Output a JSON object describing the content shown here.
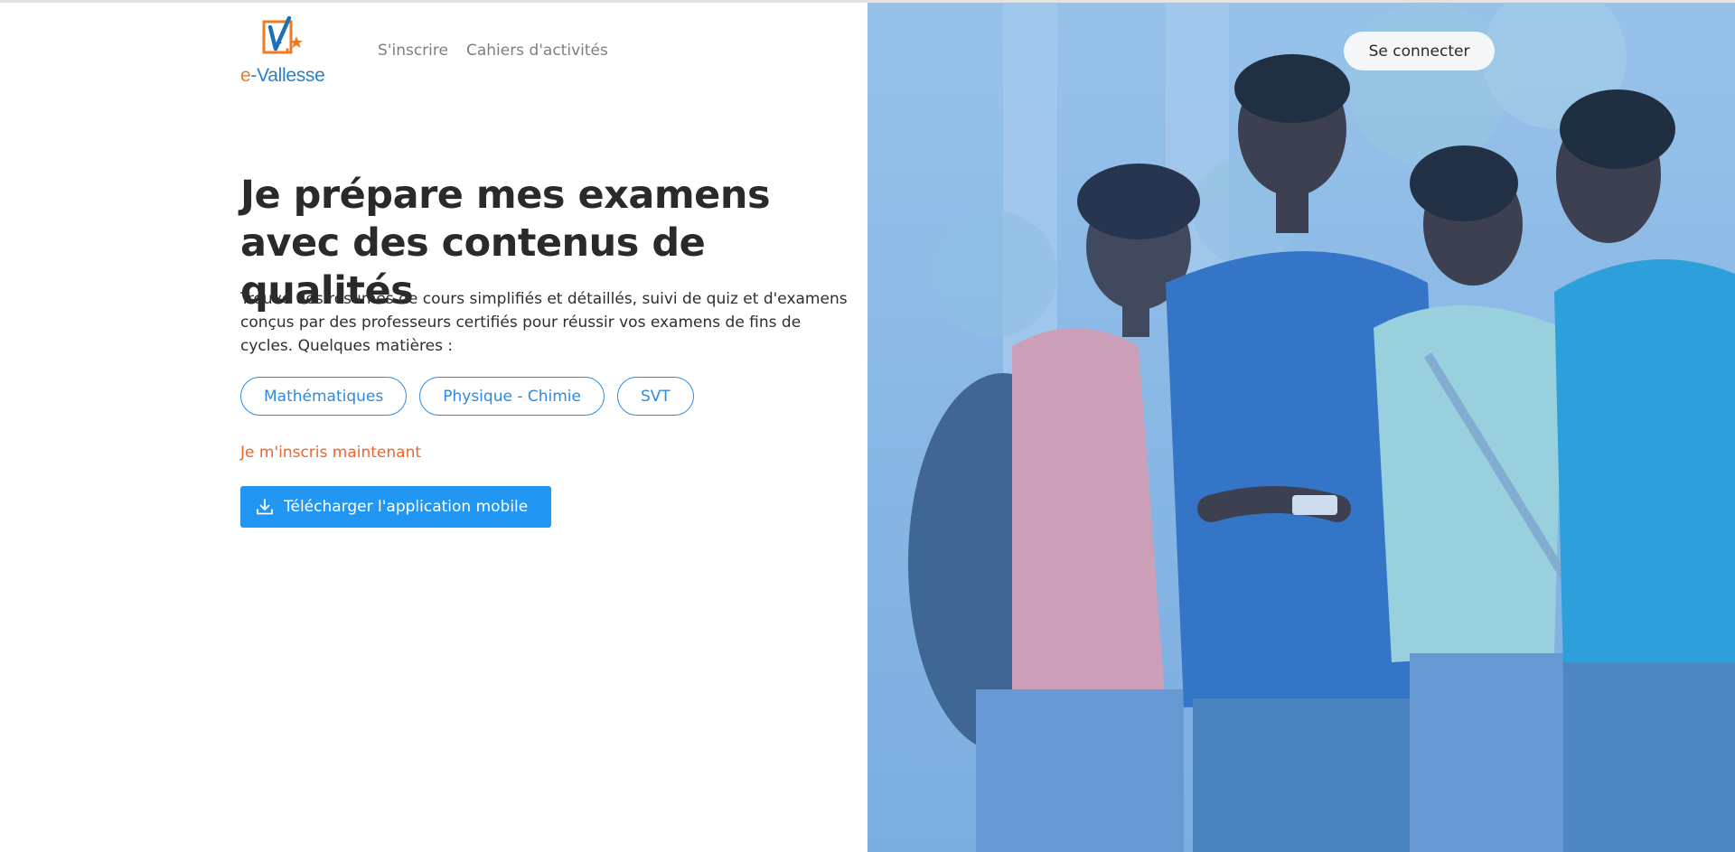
{
  "brand": {
    "logo_prefix": "e",
    "logo_name": "-Vallesse"
  },
  "nav": {
    "items": [
      {
        "label": "S'inscrire"
      },
      {
        "label": "Cahiers d'activités"
      }
    ]
  },
  "header": {
    "login_label": "Se connecter"
  },
  "hero": {
    "title": "Je prépare mes examens avec des contenus de qualités",
    "description": "Trouve des résumés de cours simplifiés et détaillés, suivi de quiz et d'examens conçus par des professeurs certifiés pour réussir vos examens de fins de cycles. Quelques matières :",
    "subjects": [
      {
        "label": "Mathématiques"
      },
      {
        "label": "Physique - Chimie"
      },
      {
        "label": "SVT"
      }
    ],
    "signup_link": "Je m'inscris maintenant",
    "download_label": "Télécharger l'application mobile",
    "download_icon": "download-icon"
  },
  "colors": {
    "accent": "#2196f3",
    "link": "#f0632a",
    "logo_orange": "#f07a22",
    "logo_blue": "#2a7fc9",
    "image_tint": "#9ec4ea"
  }
}
